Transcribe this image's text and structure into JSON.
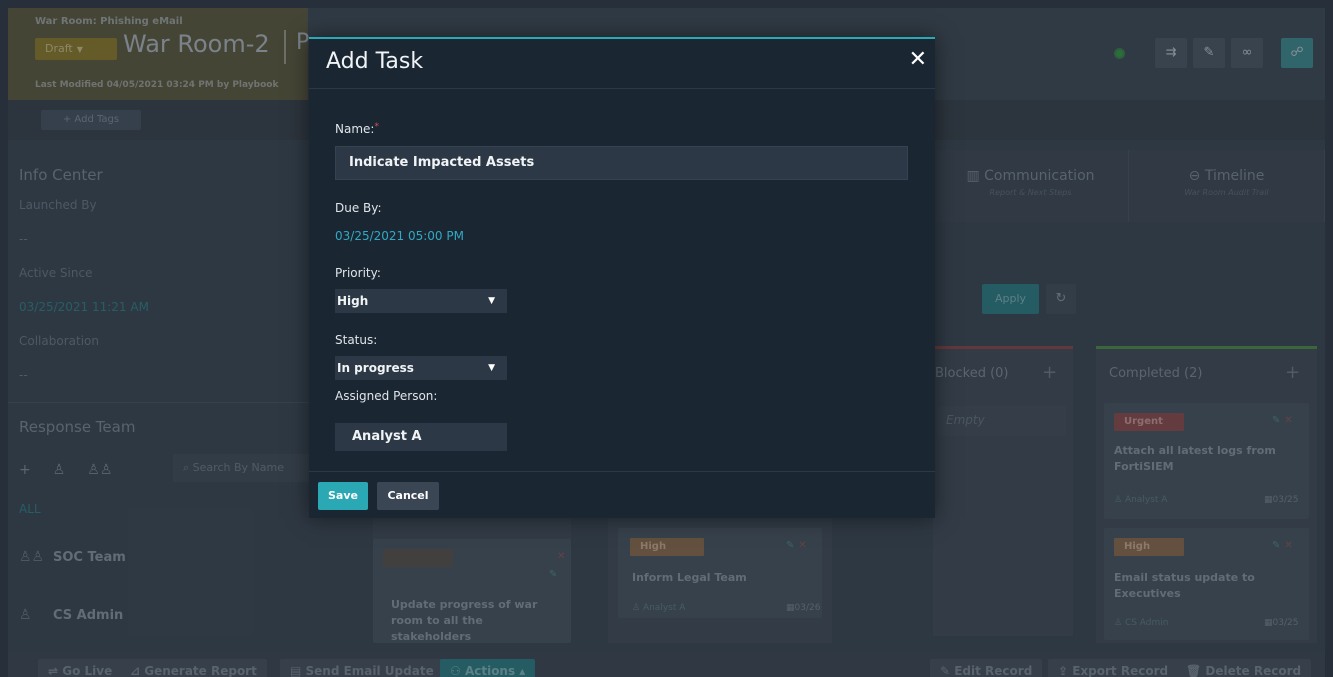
{
  "header": {
    "breadcrumb": "War Room: Phishing eMail",
    "draft_label": "Draft",
    "title": "War Room-2",
    "title_partial": "P",
    "last_modified": "Last Modified 04/05/2021 03:24 PM by Playbook"
  },
  "tags": {
    "add_label": "+ Add Tags"
  },
  "info_center": {
    "title": "Info Center",
    "launched_by_label": "Launched By",
    "launched_by_value": "--",
    "active_since_label": "Active Since",
    "active_since_value": "03/25/2021 11:21 AM",
    "collaboration_label": "Collaboration",
    "collaboration_value": "--"
  },
  "response_team": {
    "title": "Response Team",
    "search_placeholder": "Search By Name",
    "filter_all": "ALL",
    "members": [
      {
        "name": "SOC Team",
        "icon": "group-icon"
      },
      {
        "name": "CS Admin",
        "icon": "user-icon"
      }
    ]
  },
  "tabs": [
    {
      "label": "Communication",
      "sub": "Report & Next Steps",
      "icon": "chart-icon"
    },
    {
      "label": "Timeline",
      "sub": "War Room Audit Trail",
      "icon": "timeline-icon"
    }
  ],
  "filters": {
    "apply_label": "Apply"
  },
  "board": {
    "blocked": {
      "label": "Blocked (0)",
      "empty_text": "Empty"
    },
    "completed": {
      "label": "Completed (2)"
    },
    "cards": [
      {
        "priority": "",
        "title": "Update progress of war room to all the stakeholders",
        "assignee": "",
        "date": ""
      },
      {
        "priority": "High",
        "title": "Inform Legal Team",
        "assignee": "Analyst A",
        "date": "03/26"
      },
      {
        "priority": "Urgent",
        "title": "Attach all latest logs from FortiSIEM",
        "assignee": "Analyst A",
        "date": "03/25"
      },
      {
        "priority": "High",
        "title": "Email status update to Executives",
        "assignee": "CS Admin",
        "date": "03/25"
      }
    ]
  },
  "bottom_bar": {
    "go_live": "Go Live",
    "generate_report": "Generate Report",
    "send_email": "Send Email Update",
    "actions": "Actions",
    "edit_record": "Edit Record",
    "export_record": "Export Record",
    "delete_record": "Delete Record"
  },
  "modal": {
    "title": "Add Task",
    "close_glyph": "✕",
    "name_label": "Name:",
    "required_mark": "*",
    "name_value": "Indicate Impacted Assets",
    "due_label": "Due By:",
    "due_value": "03/25/2021 05:00 PM",
    "priority_label": "Priority:",
    "priority_value": "High",
    "status_label": "Status:",
    "status_value": "In progress",
    "assigned_label": "Assigned Person:",
    "assigned_value": "Analyst A",
    "save_label": "Save",
    "cancel_label": "Cancel"
  },
  "colors": {
    "accent": "#2aa8b4",
    "modal_bg": "#1b2633",
    "required": "#d9534f"
  }
}
